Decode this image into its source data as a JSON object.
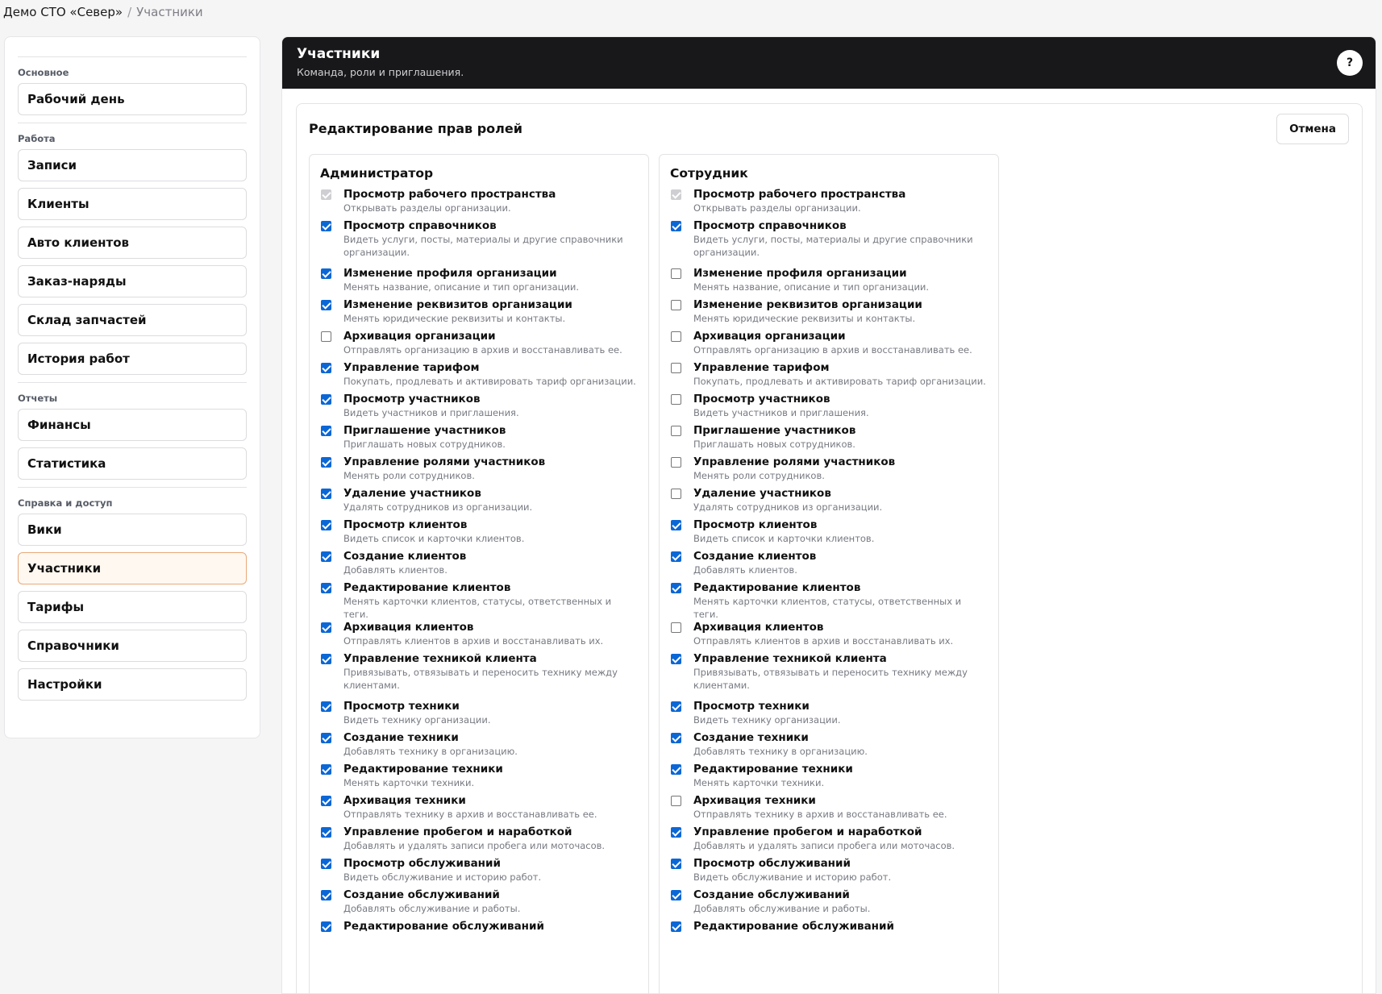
{
  "breadcrumb": {
    "org": "Демо СТО «Север»",
    "separator": "/",
    "current": "Участники"
  },
  "sidebar": {
    "groups": [
      {
        "title": "Основное",
        "items": [
          "Рабочий день"
        ]
      },
      {
        "title": "Работа",
        "items": [
          "Записи",
          "Клиенты",
          "Авто клиентов",
          "Заказ-наряды",
          "Склад запчастей",
          "История работ"
        ]
      },
      {
        "title": "Отчеты",
        "items": [
          "Финансы",
          "Статистика"
        ]
      },
      {
        "title": "Справка и доступ",
        "items": [
          "Вики",
          "Участники",
          "Тарифы",
          "Справочники",
          "Настройки"
        ]
      }
    ],
    "active": "Участники"
  },
  "header": {
    "title": "Участники",
    "subtitle": "Команда, роли и приглашения.",
    "help": "?"
  },
  "editor": {
    "title": "Редактирование прав ролей",
    "cancel": "Отмена"
  },
  "permissions": [
    {
      "name": "Просмотр рабочего пространства",
      "desc": "Открывать разделы организации."
    },
    {
      "name": "Просмотр справочников",
      "desc": "Видеть услуги, посты, материалы и другие справочники организации."
    },
    {
      "name": "Изменение профиля организации",
      "desc": "Менять название, описание и тип организации."
    },
    {
      "name": "Изменение реквизитов организации",
      "desc": "Менять юридические реквизиты и контакты."
    },
    {
      "name": "Архивация организации",
      "desc": "Отправлять организацию в архив и восстанавливать ее."
    },
    {
      "name": "Управление тарифом",
      "desc": "Покупать, продлевать и активировать тариф организации."
    },
    {
      "name": "Просмотр участников",
      "desc": "Видеть участников и приглашения."
    },
    {
      "name": "Приглашение участников",
      "desc": "Приглашать новых сотрудников."
    },
    {
      "name": "Управление ролями участников",
      "desc": "Менять роли сотрудников."
    },
    {
      "name": "Удаление участников",
      "desc": "Удалять сотрудников из организации."
    },
    {
      "name": "Просмотр клиентов",
      "desc": "Видеть список и карточки клиентов."
    },
    {
      "name": "Создание клиентов",
      "desc": "Добавлять клиентов."
    },
    {
      "name": "Редактирование клиентов",
      "desc": "Менять карточки клиентов, статусы, ответственных и теги."
    },
    {
      "name": "Архивация клиентов",
      "desc": "Отправлять клиентов в архив и восстанавливать их."
    },
    {
      "name": "Управление техникой клиента",
      "desc": "Привязывать, отвязывать и переносить технику между клиентами."
    },
    {
      "name": "Просмотр техники",
      "desc": "Видеть технику организации."
    },
    {
      "name": "Создание техники",
      "desc": "Добавлять технику в организацию."
    },
    {
      "name": "Редактирование техники",
      "desc": "Менять карточки техники."
    },
    {
      "name": "Архивация техники",
      "desc": "Отправлять технику в архив и восстанавливать ее."
    },
    {
      "name": "Управление пробегом и наработкой",
      "desc": "Добавлять и удалять записи пробега или моточасов."
    },
    {
      "name": "Просмотр обслуживаний",
      "desc": "Видеть обслуживание и историю работ."
    },
    {
      "name": "Создание обслуживаний",
      "desc": "Добавлять обслуживание и работы."
    },
    {
      "name": "Редактирование обслуживаний",
      "desc": ""
    }
  ],
  "roles": [
    {
      "name": "Администратор",
      "states": [
        "disabled",
        "on",
        "on",
        "on",
        "off",
        "on",
        "on",
        "on",
        "on",
        "on",
        "on",
        "on",
        "on",
        "on",
        "on",
        "on",
        "on",
        "on",
        "on",
        "on",
        "on",
        "on",
        "on"
      ]
    },
    {
      "name": "Сотрудник",
      "states": [
        "disabled",
        "on",
        "off",
        "off",
        "off",
        "off",
        "off",
        "off",
        "off",
        "off",
        "on",
        "on",
        "on",
        "off",
        "on",
        "on",
        "on",
        "on",
        "off",
        "on",
        "on",
        "on",
        "on"
      ]
    }
  ]
}
